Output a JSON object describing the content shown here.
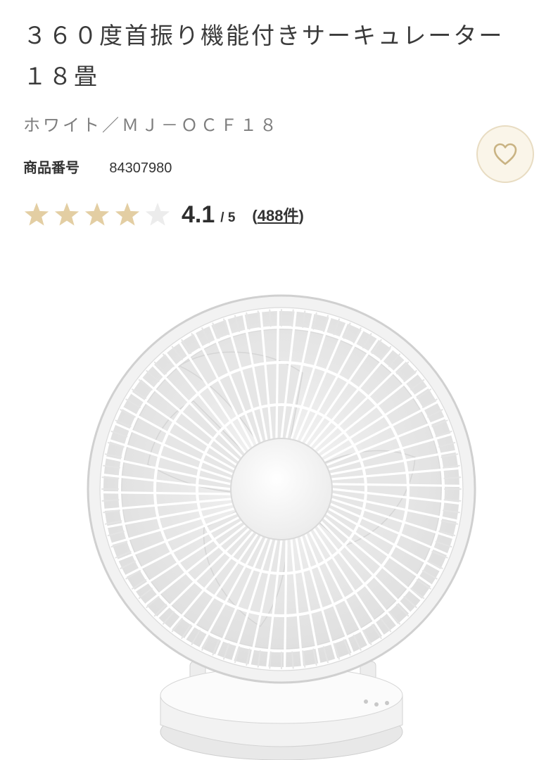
{
  "product": {
    "title": "３６０度首振り機能付きサーキュレーター　１８畳",
    "variant": "ホワイト／ＭＪ－ＯＣＦ１８",
    "code_label": "商品番号",
    "code_value": "84307980"
  },
  "rating": {
    "value": 4.1,
    "max": 5,
    "value_text": "4.1",
    "out_of_text": "/ 5",
    "reviews_open": "(",
    "reviews_text": "488件",
    "reviews_close": ")",
    "filled_stars": 4,
    "total_stars": 5
  },
  "icons": {
    "favorite": "heart-icon",
    "star_filled": "star-filled-icon",
    "star_empty": "star-empty-icon"
  },
  "colors": {
    "star_filled": "#e3cea3",
    "star_empty": "#ececec",
    "favorite_bg": "#faf5e9",
    "favorite_border": "#e8dcc2",
    "heart": "#c9b383",
    "variant_text": "#7d7d7d"
  }
}
